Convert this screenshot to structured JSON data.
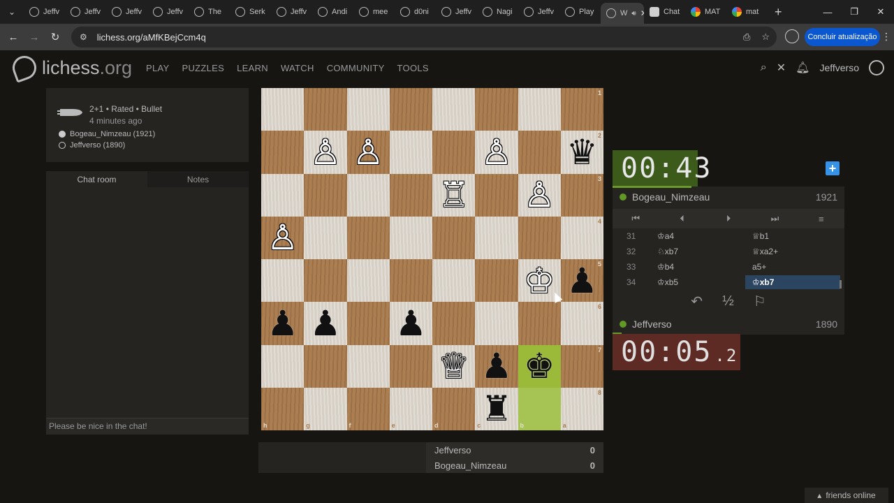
{
  "browser": {
    "tabs": [
      {
        "label": "Jeffv",
        "icon": "lichess"
      },
      {
        "label": "Jeffv",
        "icon": "lichess"
      },
      {
        "label": "Jeffv",
        "icon": "lichess"
      },
      {
        "label": "Jeffv",
        "icon": "lichess"
      },
      {
        "label": "The",
        "icon": "lichess"
      },
      {
        "label": "Serk",
        "icon": "lichess"
      },
      {
        "label": "Jeffv",
        "icon": "lichess"
      },
      {
        "label": "Andi",
        "icon": "lichess"
      },
      {
        "label": "mee",
        "icon": "lichess"
      },
      {
        "label": "d0ni",
        "icon": "lichess"
      },
      {
        "label": "Jeffv",
        "icon": "lichess"
      },
      {
        "label": "Nagi",
        "icon": "lichess"
      },
      {
        "label": "Jeffv",
        "icon": "lichess"
      },
      {
        "label": "Play",
        "icon": "lichess"
      }
    ],
    "active_tab": {
      "label": "W",
      "icon": "lichess"
    },
    "after_tabs": [
      {
        "label": "Chat",
        "icon": "chatgpt"
      },
      {
        "label": "MAT",
        "icon": "google"
      },
      {
        "label": "mat",
        "icon": "google"
      }
    ],
    "url": "lichess.org/aMfKBejCcm4q",
    "update_button": "Concluir atualização"
  },
  "site": {
    "logo_main": "lichess",
    "logo_tld": ".org",
    "nav": [
      "PLAY",
      "PUZZLES",
      "LEARN",
      "WATCH",
      "COMMUNITY",
      "TOOLS"
    ],
    "username": "Jeffverso"
  },
  "game_info": {
    "meta": "2+1 • Rated • Bullet",
    "time_ago": "4 minutes ago",
    "white_player": "Bogeau_Nimzeau (1921)",
    "black_player": "Jeffverso (1890)"
  },
  "chat": {
    "tab_chat": "Chat room",
    "tab_notes": "Notes",
    "input_placeholder": "Please be nice in the chat!"
  },
  "board": {
    "ranks": [
      "1",
      "2",
      "3",
      "4",
      "5",
      "6",
      "7",
      "8"
    ],
    "files": [
      "h",
      "g",
      "f",
      "e",
      "d",
      "c",
      "b",
      "a"
    ],
    "squares": [
      [
        "",
        "",
        "",
        "",
        "",
        "",
        "",
        ""
      ],
      [
        "",
        "wP",
        "wP",
        "",
        "",
        "wP",
        "",
        "bQ"
      ],
      [
        "",
        "",
        "",
        "",
        "wR",
        "",
        "wP",
        ""
      ],
      [
        "wP",
        "",
        "",
        "",
        "",
        "",
        "",
        ""
      ],
      [
        "",
        "",
        "",
        "",
        "",
        "",
        "wK",
        "bP"
      ],
      [
        "bP",
        "bP",
        "",
        "bP",
        "",
        "",
        "",
        ""
      ],
      [
        "",
        "",
        "",
        "",
        "wQ",
        "bP",
        "bK",
        ""
      ],
      [
        "",
        "",
        "",
        "",
        "",
        "bR",
        "",
        ""
      ]
    ],
    "highlight_squares": [
      "b7",
      "b8"
    ]
  },
  "clocks": {
    "top": {
      "main": "00:43",
      "tenths": ""
    },
    "bottom": {
      "main": "00:05",
      "tenths": "2"
    }
  },
  "players": {
    "top": {
      "name": "Bogeau_Nimzeau",
      "rating": "1921"
    },
    "bottom": {
      "name": "Jeffverso",
      "rating": "1890"
    }
  },
  "moves": [
    {
      "no": "31",
      "white": "♔a4",
      "black": "♕b1"
    },
    {
      "no": "32",
      "white": "♘xb7",
      "black": "♕xa2+"
    },
    {
      "no": "33",
      "white": "♔b4",
      "black": "a5+"
    },
    {
      "no": "34",
      "white": "♔xb5",
      "black": "♔xb7"
    }
  ],
  "crosstable": [
    {
      "name": "Jeffverso",
      "score": "0"
    },
    {
      "name": "Bogeau_Nimzeau",
      "score": "0"
    }
  ],
  "friends": "friends online"
}
